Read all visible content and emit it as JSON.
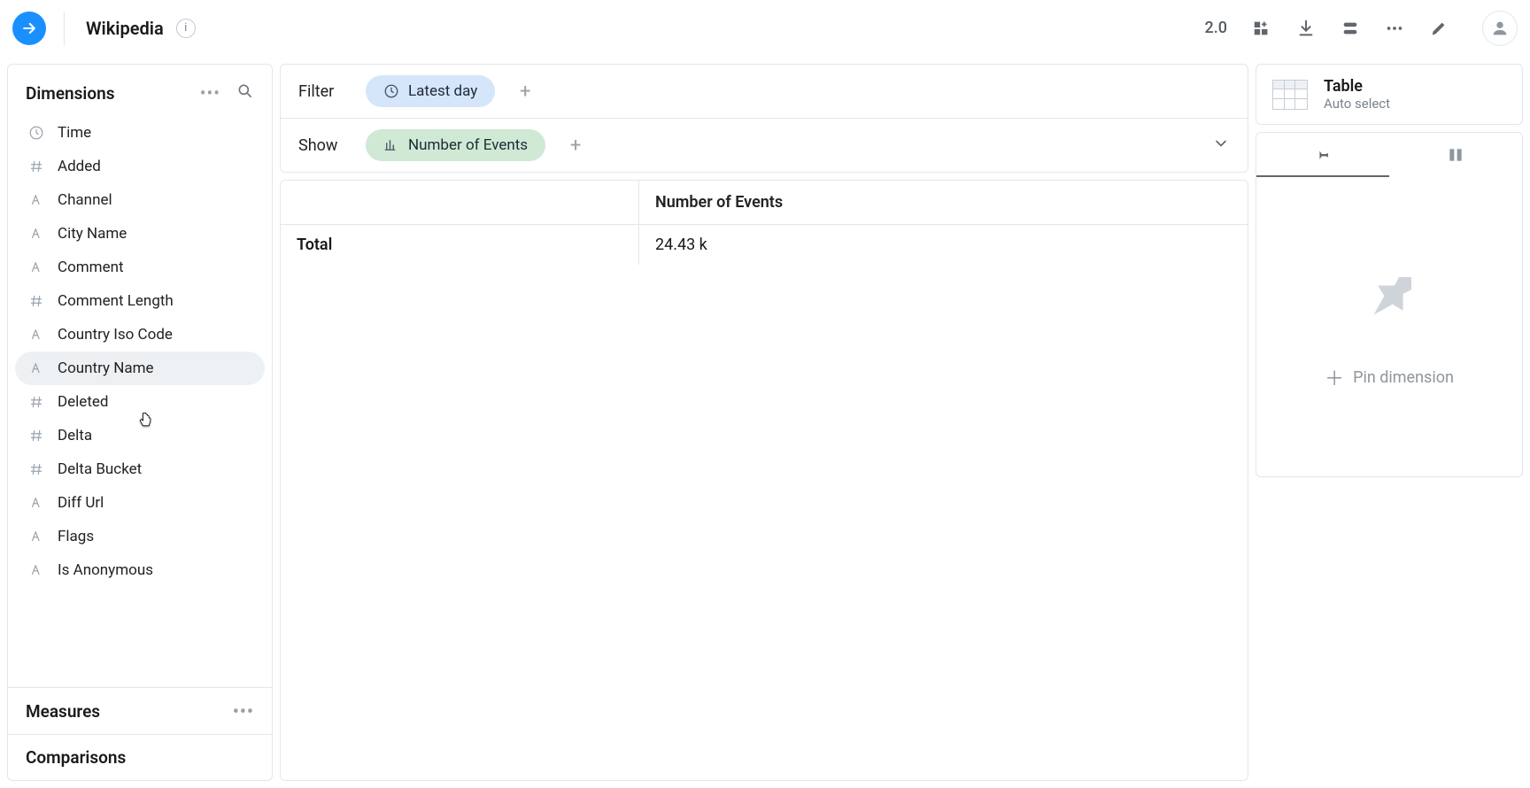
{
  "header": {
    "title": "Wikipedia",
    "version": "2.0"
  },
  "sidebar": {
    "dimensions_label": "Dimensions",
    "items": [
      {
        "label": "Time",
        "icon": "clock"
      },
      {
        "label": "Added",
        "icon": "hash"
      },
      {
        "label": "Channel",
        "icon": "text"
      },
      {
        "label": "City Name",
        "icon": "text"
      },
      {
        "label": "Comment",
        "icon": "text"
      },
      {
        "label": "Comment Length",
        "icon": "hash"
      },
      {
        "label": "Country Iso Code",
        "icon": "text"
      },
      {
        "label": "Country Name",
        "icon": "text",
        "hovered": true
      },
      {
        "label": "Deleted",
        "icon": "hash"
      },
      {
        "label": "Delta",
        "icon": "hash"
      },
      {
        "label": "Delta Bucket",
        "icon": "hash"
      },
      {
        "label": "Diff Url",
        "icon": "text"
      },
      {
        "label": "Flags",
        "icon": "text"
      },
      {
        "label": "Is Anonymous",
        "icon": "text"
      }
    ],
    "measures_label": "Measures",
    "comparisons_label": "Comparisons"
  },
  "query": {
    "filter_label": "Filter",
    "filter_pill": "Latest day",
    "show_label": "Show",
    "show_pill": "Number of Events"
  },
  "table": {
    "column_header": "Number of Events",
    "row_label": "Total",
    "row_value": "24.43 k"
  },
  "right": {
    "viz_title": "Table",
    "viz_subtitle": "Auto select",
    "pin_cta": "Pin dimension"
  }
}
